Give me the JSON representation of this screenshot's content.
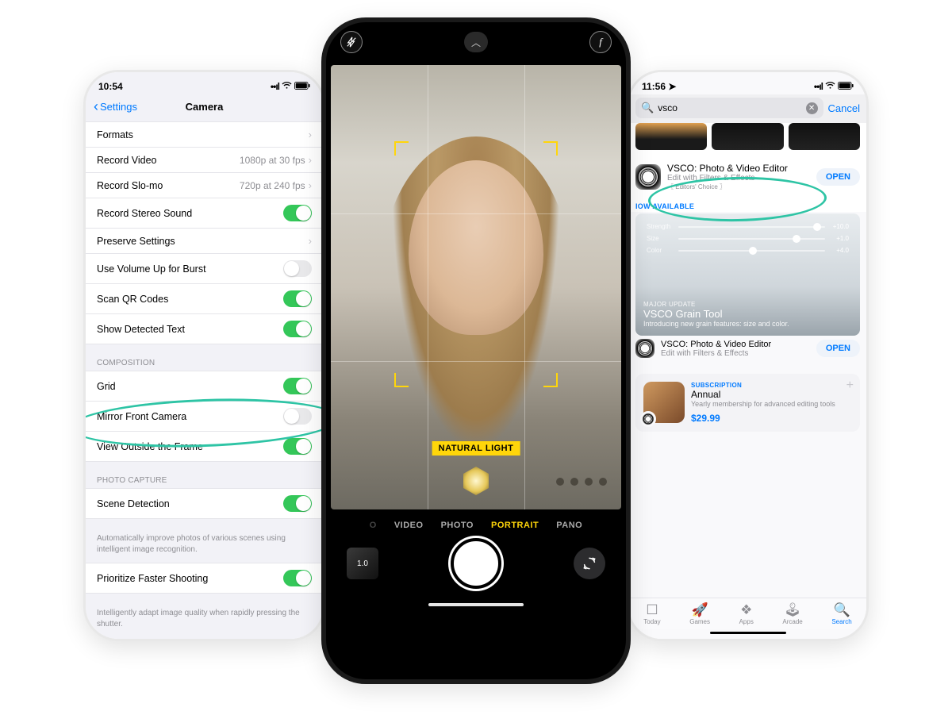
{
  "left": {
    "time": "10:54",
    "back_label": "Settings",
    "title": "Camera",
    "group1": [
      {
        "label": "Formats",
        "type": "chev"
      },
      {
        "label": "Record Video",
        "detail": "1080p at 30 fps",
        "type": "chev"
      },
      {
        "label": "Record Slo-mo",
        "detail": "720p at 240 fps",
        "type": "chev"
      },
      {
        "label": "Record Stereo Sound",
        "type": "toggle",
        "on": true
      },
      {
        "label": "Preserve Settings",
        "type": "chev"
      },
      {
        "label": "Use Volume Up for Burst",
        "type": "toggle",
        "on": false
      },
      {
        "label": "Scan QR Codes",
        "type": "toggle",
        "on": true
      },
      {
        "label": "Show Detected Text",
        "type": "toggle",
        "on": true
      }
    ],
    "section_composition": "COMPOSITION",
    "group2": [
      {
        "label": "Grid",
        "type": "toggle",
        "on": true
      },
      {
        "label": "Mirror Front Camera",
        "type": "toggle",
        "on": false
      },
      {
        "label": "View Outside the Frame",
        "type": "toggle",
        "on": true
      }
    ],
    "section_capture": "PHOTO CAPTURE",
    "group3": [
      {
        "label": "Scene Detection",
        "type": "toggle",
        "on": true
      }
    ],
    "footer_scene": "Automatically improve photos of various scenes using intelligent image recognition.",
    "group4": [
      {
        "label": "Prioritize Faster Shooting",
        "type": "toggle",
        "on": true
      }
    ],
    "footer_prio": "Intelligently adapt image quality when rapidly pressing the shutter."
  },
  "center": {
    "lighting_label": "NATURAL LIGHT",
    "modes": [
      "VIDEO",
      "PHOTO",
      "PORTRAIT",
      "PANO"
    ],
    "active_mode": "PORTRAIT",
    "last_thumb": "1.0"
  },
  "right": {
    "time": "11:56",
    "search_value": "vsco",
    "cancel_label": "Cancel",
    "result_title": "VSCO: Photo & Video Editor",
    "result_sub": "Edit with Filters & Effects",
    "editors_choice": "Editors' Choice",
    "open_label": "OPEN",
    "now_available": "IOW AVAILABLE",
    "promo": {
      "sliders": [
        {
          "label": "Strength",
          "val": "+10.0",
          "pos": 0.92
        },
        {
          "label": "Size",
          "val": "+1.0",
          "pos": 0.78
        },
        {
          "label": "Color",
          "val": "+4.0",
          "pos": 0.48
        }
      ],
      "kicker": "MAJOR UPDATE",
      "title": "VSCO Grain Tool",
      "sub": "Introducing new grain features: size and color."
    },
    "result2_title": "VSCO: Photo & Video Editor",
    "result2_sub": "Edit with Filters & Effects",
    "inapp": {
      "kicker": "SUBSCRIPTION",
      "title": "Annual",
      "sub": "Yearly membership for advanced editing tools",
      "price": "$29.99"
    },
    "tabs": [
      {
        "icon": "☐",
        "label": "Today"
      },
      {
        "icon": "🚀",
        "label": "Games"
      },
      {
        "icon": "❖",
        "label": "Apps"
      },
      {
        "icon": "🕹",
        "label": "Arcade"
      },
      {
        "icon": "🔍",
        "label": "Search"
      }
    ],
    "active_tab": "Search"
  }
}
